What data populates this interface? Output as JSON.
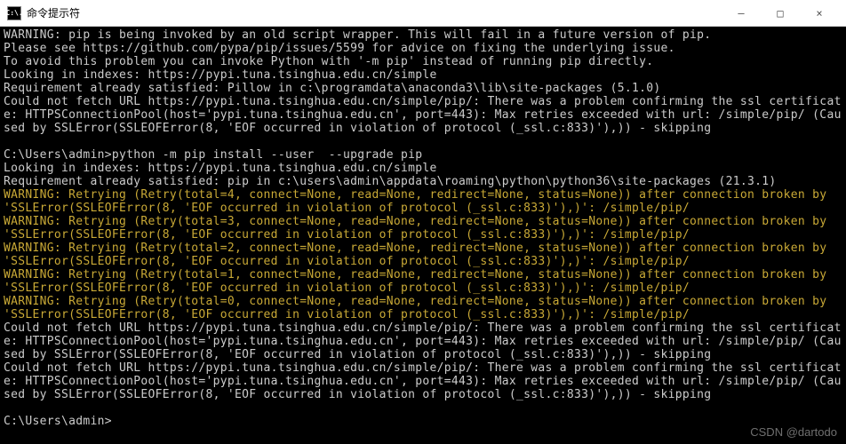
{
  "titlebar": {
    "icon_label": "C:\\.",
    "title": "命令提示符"
  },
  "window_buttons": {
    "minimize": "—",
    "maximize": "□",
    "close": "×"
  },
  "lines": [
    {
      "cls": "white",
      "text": "WARNING: pip is being invoked by an old script wrapper. This will fail in a future version of pip."
    },
    {
      "cls": "white",
      "text": "Please see https://github.com/pypa/pip/issues/5599 for advice on fixing the underlying issue."
    },
    {
      "cls": "white",
      "text": "To avoid this problem you can invoke Python with '-m pip' instead of running pip directly."
    },
    {
      "cls": "white",
      "text": "Looking in indexes: https://pypi.tuna.tsinghua.edu.cn/simple"
    },
    {
      "cls": "white",
      "text": "Requirement already satisfied: Pillow in c:\\programdata\\anaconda3\\lib\\site-packages (5.1.0)"
    },
    {
      "cls": "white",
      "text": "Could not fetch URL https://pypi.tuna.tsinghua.edu.cn/simple/pip/: There was a problem confirming the ssl certificate: HTTPSConnectionPool(host='pypi.tuna.tsinghua.edu.cn', port=443): Max retries exceeded with url: /simple/pip/ (Caused by SSLError(SSLEOFError(8, 'EOF occurred in violation of protocol (_ssl.c:833)'),)) - skipping"
    },
    {
      "cls": "white",
      "text": ""
    },
    {
      "cls": "white",
      "text": "C:\\Users\\admin>python -m pip install --user  --upgrade pip"
    },
    {
      "cls": "white",
      "text": "Looking in indexes: https://pypi.tuna.tsinghua.edu.cn/simple"
    },
    {
      "cls": "white",
      "text": "Requirement already satisfied: pip in c:\\users\\admin\\appdata\\roaming\\python\\python36\\site-packages (21.3.1)"
    },
    {
      "cls": "warn",
      "text": "WARNING: Retrying (Retry(total=4, connect=None, read=None, redirect=None, status=None)) after connection broken by 'SSLError(SSLEOFError(8, 'EOF occurred in violation of protocol (_ssl.c:833)'),)': /simple/pip/"
    },
    {
      "cls": "warn",
      "text": "WARNING: Retrying (Retry(total=3, connect=None, read=None, redirect=None, status=None)) after connection broken by 'SSLError(SSLEOFError(8, 'EOF occurred in violation of protocol (_ssl.c:833)'),)': /simple/pip/"
    },
    {
      "cls": "warn",
      "text": "WARNING: Retrying (Retry(total=2, connect=None, read=None, redirect=None, status=None)) after connection broken by 'SSLError(SSLEOFError(8, 'EOF occurred in violation of protocol (_ssl.c:833)'),)': /simple/pip/"
    },
    {
      "cls": "warn",
      "text": "WARNING: Retrying (Retry(total=1, connect=None, read=None, redirect=None, status=None)) after connection broken by 'SSLError(SSLEOFError(8, 'EOF occurred in violation of protocol (_ssl.c:833)'),)': /simple/pip/"
    },
    {
      "cls": "warn",
      "text": "WARNING: Retrying (Retry(total=0, connect=None, read=None, redirect=None, status=None)) after connection broken by 'SSLError(SSLEOFError(8, 'EOF occurred in violation of protocol (_ssl.c:833)'),)': /simple/pip/"
    },
    {
      "cls": "white",
      "text": "Could not fetch URL https://pypi.tuna.tsinghua.edu.cn/simple/pip/: There was a problem confirming the ssl certificate: HTTPSConnectionPool(host='pypi.tuna.tsinghua.edu.cn', port=443): Max retries exceeded with url: /simple/pip/ (Caused by SSLError(SSLEOFError(8, 'EOF occurred in violation of protocol (_ssl.c:833)'),)) - skipping"
    },
    {
      "cls": "white",
      "text": "Could not fetch URL https://pypi.tuna.tsinghua.edu.cn/simple/pip/: There was a problem confirming the ssl certificate: HTTPSConnectionPool(host='pypi.tuna.tsinghua.edu.cn', port=443): Max retries exceeded with url: /simple/pip/ (Caused by SSLError(SSLEOFError(8, 'EOF occurred in violation of protocol (_ssl.c:833)'),)) - skipping"
    },
    {
      "cls": "white",
      "text": ""
    },
    {
      "cls": "white",
      "text": "C:\\Users\\admin>"
    }
  ],
  "watermark": "CSDN @dartodo"
}
